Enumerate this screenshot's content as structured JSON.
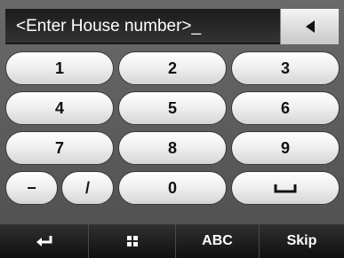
{
  "input": {
    "display_text": "<Enter House number>_",
    "backspace_icon": "backspace-triangle-icon"
  },
  "keypad": {
    "keys": [
      "1",
      "2",
      "3",
      "4",
      "5",
      "6",
      "7",
      "8",
      "9",
      "−",
      "/",
      "0"
    ],
    "space_icon": "space-bar-icon"
  },
  "toolbar": {
    "back_icon": "return-arrow-icon",
    "grid_icon": "grid-icon",
    "abc_label": "ABC",
    "skip_label": "Skip"
  },
  "colors": {
    "background": "#5a5a5a",
    "input_background": "#222222",
    "key_face": "#f0f0f0",
    "toolbar": "#1a1a1a"
  }
}
